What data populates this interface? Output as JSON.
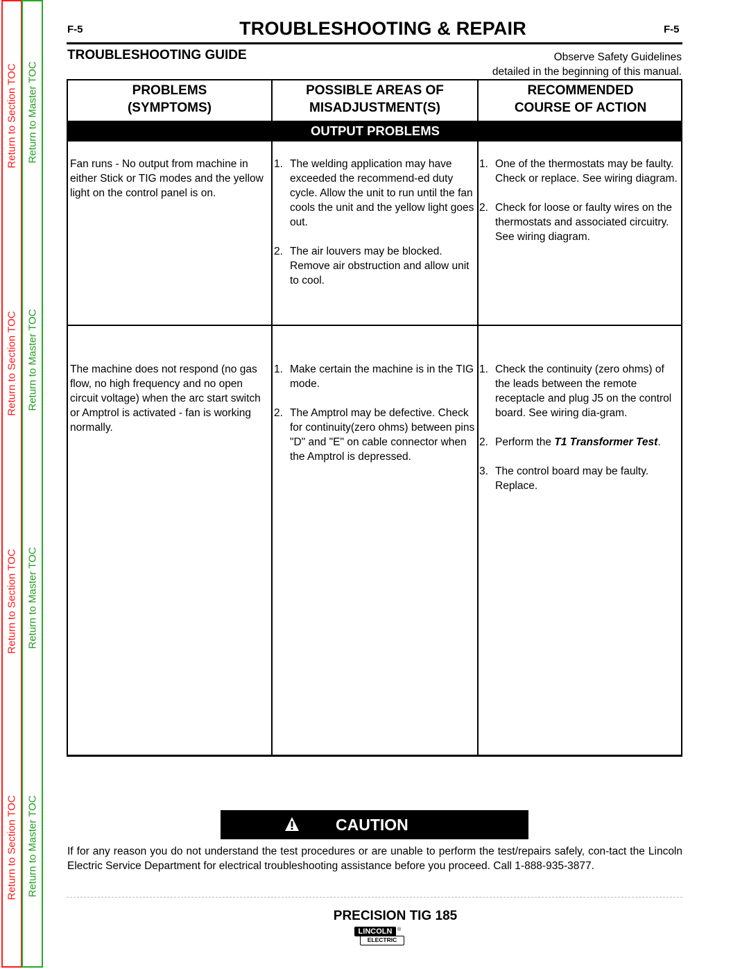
{
  "toc": {
    "section_label": "Return to Section TOC",
    "master_label": "Return to Master TOC",
    "section_color": "#ff1a1a",
    "master_color": "#22aa22"
  },
  "header": {
    "page_number_left": "F-5",
    "page_number_right": "F-5",
    "title": "TROUBLESHOOTING & REPAIR",
    "guide_title": "TROUBLESHOOTING GUIDE",
    "safety_line1": "Observe Safety Guidelines",
    "safety_line2": "detailed in the beginning of this manual."
  },
  "table": {
    "columns": [
      {
        "line1": "PROBLEMS",
        "line2": "(SYMPTOMS)"
      },
      {
        "line1": "POSSIBLE AREAS OF",
        "line2": "MISADJUSTMENT(S)"
      },
      {
        "line1": "RECOMMENDED",
        "line2": "COURSE OF ACTION"
      }
    ],
    "section_band": "OUTPUT PROBLEMS",
    "rows": [
      {
        "symptom": "Fan runs -  No output from machine in either Stick or TIG modes and the yellow light on the control panel is on.",
        "causes": [
          {
            "num": "1.",
            "text": "The welding application may have exceeded the recommend-ed duty cycle.  Allow the unit to run until the fan cools the unit and the yellow light goes out."
          },
          {
            "num": "2.",
            "text": "The air louvers may be blocked. Remove air obstruction and allow unit to cool."
          }
        ],
        "actions": [
          {
            "num": "1.",
            "text": "One of the thermostats may be faulty.  Check or replace.  See wiring diagram."
          },
          {
            "num": "2.",
            "text": "Check for loose or faulty wires on the thermostats and associated circuitry.  See wiring diagram."
          }
        ]
      },
      {
        "symptom": "The machine does not respond (no gas flow, no high frequency and no open circuit voltage)  when the arc start switch or Amptrol is activated - fan is working normally.",
        "causes": [
          {
            "num": "1.",
            "text": "Make certain the machine is in the TIG mode."
          },
          {
            "num": "2.",
            "text": "The Amptrol may be defective. Check for continuity(zero ohms) between pins \"D\" and \"E\" on cable connector when the Amptrol is depressed."
          }
        ],
        "actions": [
          {
            "num": "1.",
            "text": "Check the continuity (zero ohms) of the leads between the remote receptacle and plug J5 on the control board.  See wiring dia-gram."
          },
          {
            "num": "2.",
            "text_prefix": "Perform the ",
            "text_emph": "T1 Transformer Test",
            "text_suffix": "."
          },
          {
            "num": "3.",
            "text": "The control board may be faulty. Replace."
          }
        ]
      }
    ]
  },
  "caution": {
    "icon": "warning-triangle-icon",
    "label": "CAUTION",
    "text": "If for any reason you do not understand the test procedures or are unable to perform the test/repairs safely, con-tact the Lincoln Electric Service Department for electrical troubleshooting assistance before you proceed.  Call 1-888-935-3877."
  },
  "footer": {
    "product": "PRECISION TIG 185",
    "logo_top": "LINCOLN",
    "logo_bottom": "ELECTRIC",
    "logo_reg": "®"
  }
}
